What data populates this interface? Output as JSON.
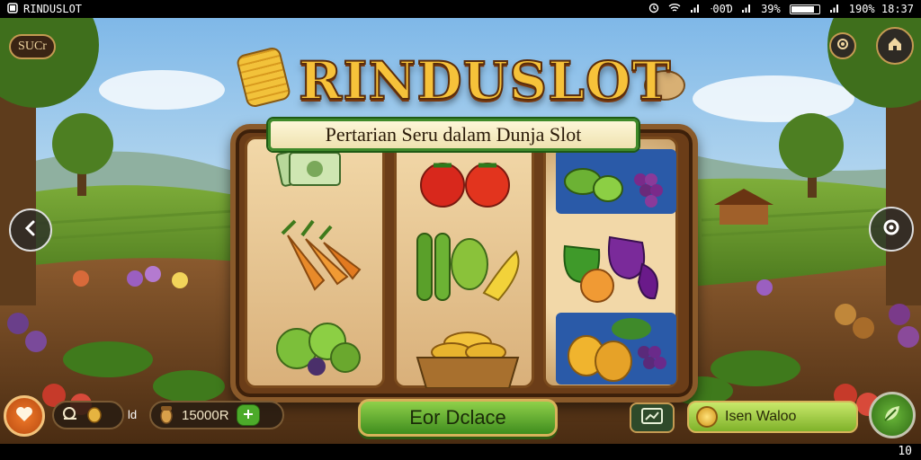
{
  "status_bar": {
    "app_name": "RINDUSLOT",
    "signal_text": "ᐧ00Ɗ",
    "battery_percent": "39%",
    "right_text": "190% 18:37"
  },
  "game": {
    "title": "RINDUSLOT",
    "subtitle": "Pertarian Seru dalam Dunja Slot",
    "top_left_badge": "SUCr",
    "balance": "15000R",
    "small_label": "ld",
    "main_button": "Eor Dclace",
    "wallet_button": "Isen Waloo"
  },
  "colors": {
    "title_gold": "#f6c23a",
    "button_green": "#5fae2e",
    "frame_brown": "#6b3d18"
  },
  "bottom_bar": {
    "page_number": "10"
  }
}
